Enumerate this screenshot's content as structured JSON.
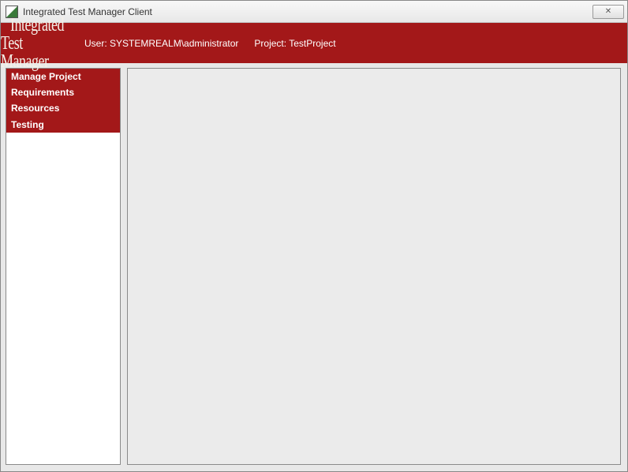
{
  "window": {
    "title": "Integrated Test Manager Client"
  },
  "header": {
    "logo_line1": "Integrated",
    "logo_line2": "Test Manager",
    "user_label": "User:",
    "user_value": "SYSTEMREALM\\administrator",
    "project_label": "Project:",
    "project_value": "TestProject"
  },
  "sidebar": {
    "items": [
      {
        "label": "Manage Project"
      },
      {
        "label": "Requirements"
      },
      {
        "label": "Resources"
      },
      {
        "label": "Testing"
      }
    ]
  },
  "close_glyph": "✕"
}
